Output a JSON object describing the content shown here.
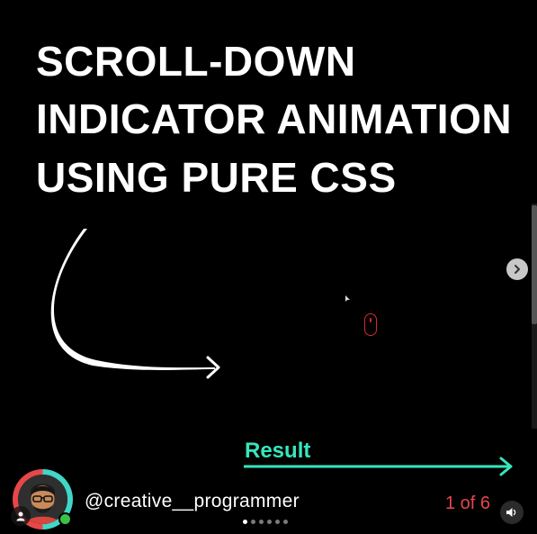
{
  "slide": {
    "title_lines": [
      "SCROLL-DOWN",
      "INDICATOR ANIMATION",
      "USING PURE CSS"
    ],
    "result_label": "Result"
  },
  "colors": {
    "background": "#000000",
    "title": "#ffffff",
    "result_accent": "#35e6bd",
    "indicator_red": "#d12c35",
    "counter_red": "#e6474a"
  },
  "footer": {
    "username": "@creative__programmer",
    "slide_counter": "1 of 6",
    "pagination_total": 6,
    "pagination_active": 1
  },
  "icons": {
    "big_arrow": "curved-arrow-icon",
    "next": "chevron-right-icon",
    "volume": "speaker-icon",
    "user": "user-icon",
    "cursor": "pointer-cursor-icon"
  }
}
